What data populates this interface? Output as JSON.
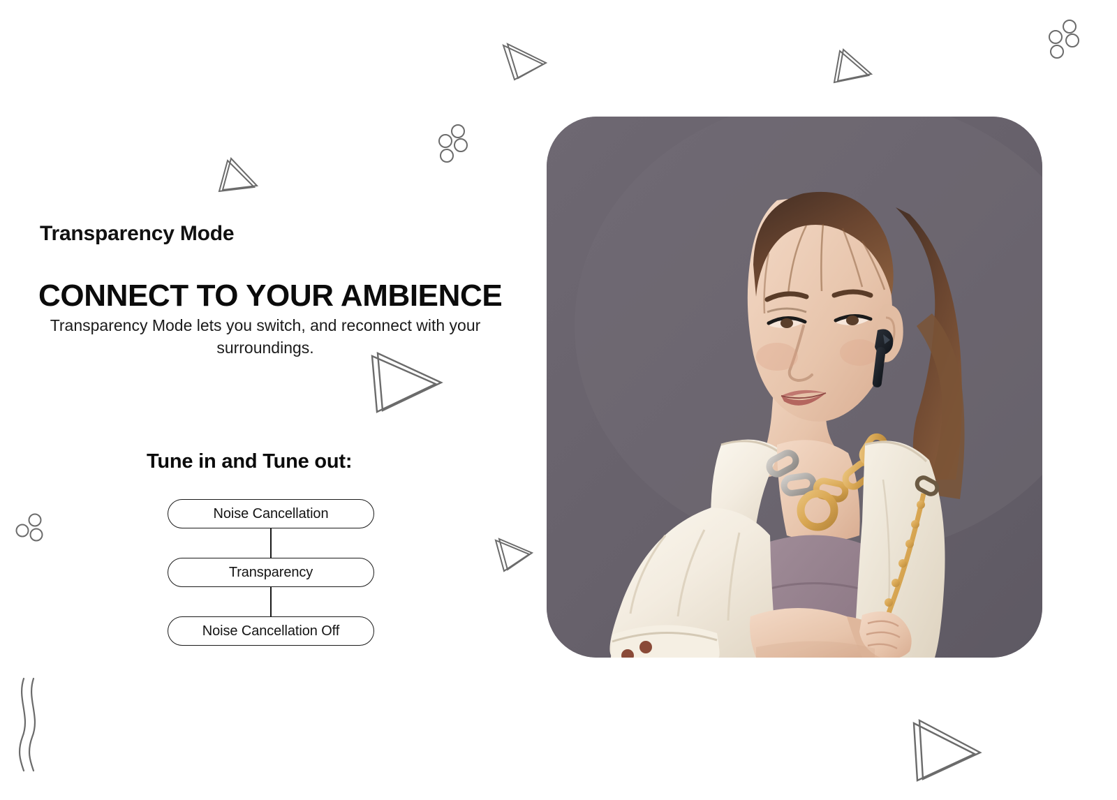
{
  "slide": {
    "background_color": "#ffffff",
    "text_color": "#111111"
  },
  "left": {
    "eyebrow": "Transparency Mode",
    "headline": "CONNECT TO YOUR AMBIENCE",
    "subcopy": "Transparency Mode lets you switch, and reconnect with your surroundings."
  },
  "flow": {
    "title": "Tune in and Tune out:",
    "steps": [
      {
        "label": "Noise Cancellation"
      },
      {
        "label": "Transparency"
      },
      {
        "label": "Noise Cancellation Off"
      }
    ],
    "border_color": "#1a1a1a"
  },
  "photo": {
    "alt": "Woman wearing cream jacket and black wireless earbud",
    "background_color": "#666069",
    "corner_radius_px": 72
  },
  "decorations": {
    "stroke_color": "#6b6b6b",
    "items": [
      {
        "name": "triangle-top-left-small",
        "type": "triangle"
      },
      {
        "name": "triangle-top-center",
        "type": "triangle"
      },
      {
        "name": "triangle-top-right",
        "type": "triangle"
      },
      {
        "name": "triangle-mid-left",
        "type": "triangle"
      },
      {
        "name": "triangle-mid-center",
        "type": "triangle"
      },
      {
        "name": "triangle-bottom-right",
        "type": "triangle"
      },
      {
        "name": "circles-top-center",
        "type": "circle-cluster"
      },
      {
        "name": "circles-top-right",
        "type": "circle-cluster"
      },
      {
        "name": "circles-left",
        "type": "circle-cluster"
      },
      {
        "name": "wavy-lines-bottom-left",
        "type": "wave"
      }
    ]
  }
}
